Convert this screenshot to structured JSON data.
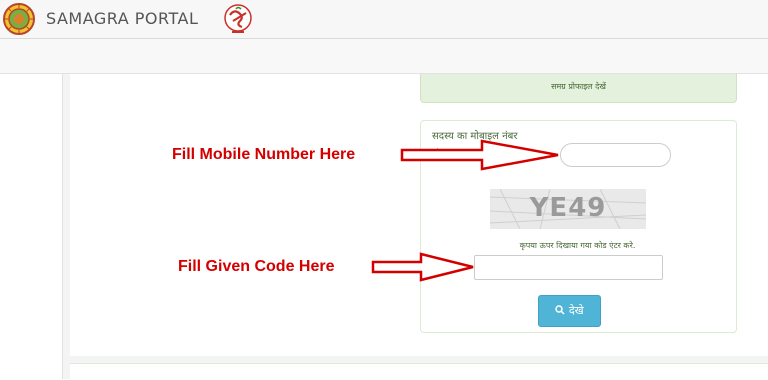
{
  "header": {
    "brand": "SAMAGRA PORTAL",
    "logo_icon": "mp-emblem-icon",
    "samagra_logo_icon": "samagra-s-logo-icon"
  },
  "panel": {
    "profile_link": "समग्र प्रोफाइल देखें",
    "mobile_label": "सदस्य का मोबाइल नंबर",
    "mobile_hint": ":",
    "mobile_value": "",
    "captcha_text": "YE49",
    "captcha_note": "कृपया ऊपर दिखाया गया कोड एंटर करे.",
    "code_value": "",
    "view_button": "देखे",
    "view_button_icon": "search-icon"
  },
  "annotations": {
    "mobile": "Fill Mobile Number Here",
    "code": "Fill Given Code Here"
  },
  "colors": {
    "annotation_red": "#d40000",
    "button_blue": "#4fb4d6",
    "green_bg": "#e3f1dd"
  }
}
